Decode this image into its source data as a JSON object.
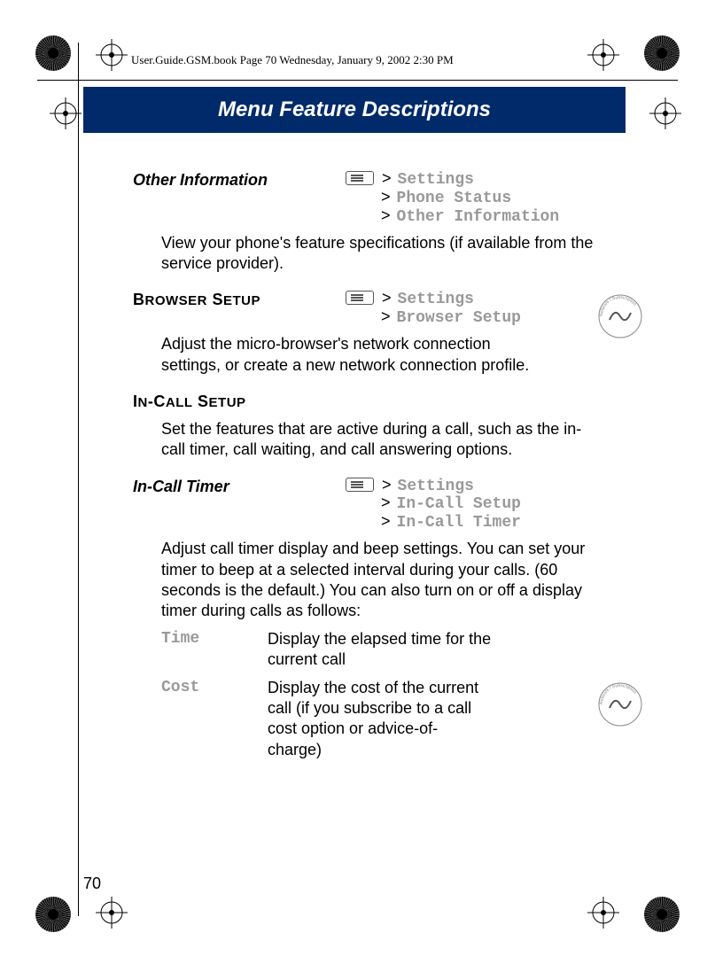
{
  "header_line": "User.Guide.GSM.book  Page 70  Wednesday, January 9, 2002  2:30 PM",
  "chapter_title": "Menu Feature Descriptions",
  "page_number": "70",
  "sections": {
    "other_info": {
      "label": "Other Information",
      "nav": [
        "Settings",
        "Phone Status",
        "Other Information"
      ],
      "body": "View your phone's feature specifications (if available from the service provider)."
    },
    "browser_setup": {
      "label": "Browser Setup",
      "nav": [
        "Settings",
        "Browser Setup"
      ],
      "body": "Adjust the micro-browser's network connection settings, or create a new network connection profile.",
      "badge": "Network / Subscription Dependent Feature"
    },
    "incall_setup": {
      "label": "In-Call Setup",
      "body": "Set the features that are active during a call, such as the in-call timer, call waiting, and call answering options."
    },
    "incall_timer": {
      "label": "In-Call Timer",
      "nav": [
        "Settings",
        "In-Call Setup",
        "In-Call Timer"
      ],
      "body": "Adjust call timer display and beep settings. You can set your timer to beep at a selected interval during your calls. (60 seconds is the default.) You can also turn on or off a display timer during calls as follows:",
      "options": [
        {
          "key": "Time",
          "val": "Display the elapsed time for the current call"
        },
        {
          "key": "Cost",
          "val": "Display the cost of the current call (if you subscribe to a call cost option or advice-of-charge)"
        }
      ],
      "badge": "Network / Subscription Dependent Feature"
    }
  }
}
